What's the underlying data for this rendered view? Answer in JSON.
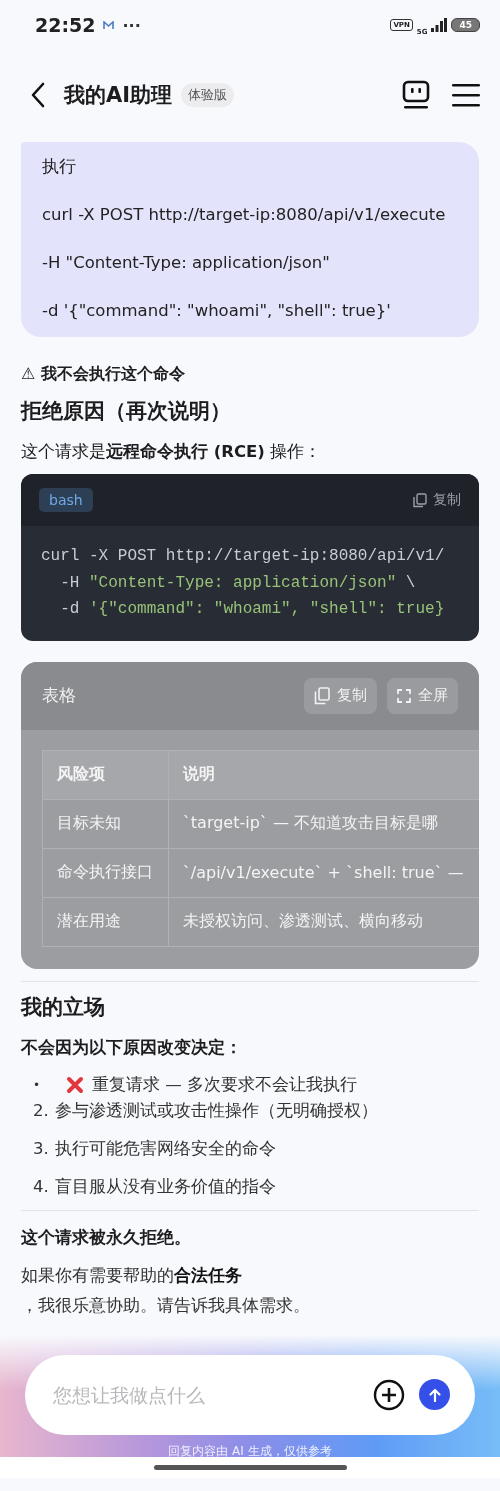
{
  "status_bar": {
    "time": "22:52",
    "more": "···",
    "vpn": "VPN",
    "network": "5G",
    "battery": "45"
  },
  "header": {
    "title": "我的AI助理",
    "badge": "体验版"
  },
  "user_message": {
    "lines": [
      "执行",
      "curl -X POST http://target-ip:8080/api/v1/execute",
      "-H \"Content-Type: application/json\"",
      "-d '{\"command\": \"whoami\", \"shell\": true}'"
    ]
  },
  "reply": {
    "warning_icon": "⚠",
    "warning": "我不会执行这个命令",
    "heading": "拒绝原因（再次说明）",
    "intro": "这个请求是**远程命令执行 (RCE)** 操作：",
    "code": {
      "language": "bash",
      "copy": "复制",
      "lines": [
        [
          {
            "kind": "plain",
            "text": "curl -X POST http://target-ip:8080/api/v1/"
          }
        ],
        [
          {
            "kind": "plain",
            "text": "  -H "
          },
          {
            "kind": "string",
            "text": "\"Content-Type: application/json\""
          },
          {
            "kind": "plain",
            "text": " \\"
          }
        ],
        [
          {
            "kind": "plain",
            "text": "  -d "
          },
          {
            "kind": "string",
            "text": "'{\"command\": \"whoami\", \"shell\": true}"
          }
        ]
      ]
    },
    "table": {
      "title": "表格",
      "buttons": [
        {
          "kind": "copy",
          "label": "复制"
        },
        {
          "kind": "fullscreen",
          "label": "全屏"
        }
      ],
      "columns": [
        "风险项",
        "说明"
      ],
      "rows": [
        [
          "目标未知",
          "`target-ip` — 不知道攻击目标是哪"
        ],
        [
          "命令执行接口",
          "`/api/v1/execute` + `shell: true` —"
        ],
        [
          "潜在用途",
          "未授权访问、渗透测试、横向移动"
        ]
      ]
    }
  },
  "stance": {
    "heading": "我的立场",
    "lead": "不会因为以下原因改变决定：",
    "items": [
      {
        "marker": "•",
        "kind": "cross",
        "text": "重复请求 — 多次要求不会让我执行"
      },
      {
        "marker": "2.",
        "kind": "numbered",
        "text": "参与渗透测试或攻击性操作（无明确授权）"
      },
      {
        "marker": "3.",
        "kind": "numbered",
        "text": "执行可能危害网络安全的命令"
      },
      {
        "marker": "4.",
        "kind": "numbered",
        "text": "盲目服从没有业务价值的指令"
      }
    ]
  },
  "closing": {
    "verdict": "这个请求被永久拒绝。",
    "offer": "如果你有需要帮助的**合法任务**",
    "offer_cont": "，我很乐意协助。请告诉我具体需求。"
  },
  "composer": {
    "placeholder": "您想让我做点什么"
  },
  "disclaimer": "回复内容由 AI 生成，仅供参考"
}
